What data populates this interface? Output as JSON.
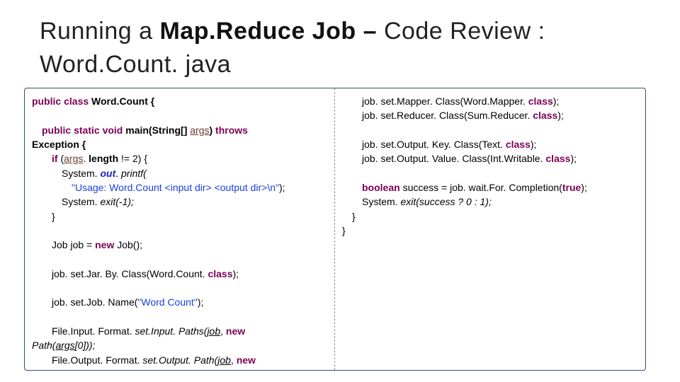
{
  "title": {
    "pre": "Running a ",
    "bold1": "Map.Reduce Job – ",
    "post": "Code Review :",
    "sub": "Word.Count. java"
  },
  "left": {
    "l1a": "public class ",
    "l1b": "Word.Count {",
    "l2a": "public static void ",
    "l2b": "main(String[] ",
    "l2c": "args",
    "l2d": ") ",
    "l2e": "throws",
    "l3a": "Exception {",
    "l4a": "if ",
    "l4b": "(",
    "l4c": "args",
    "l4d": ". ",
    "l4e": "length",
    "l4f": " != 2) {",
    "l5a": "System. ",
    "l5b": "out",
    "l5c": ". ",
    "l5d": "printf(",
    "l6a": "\"Usage: Word.Count <input dir> <output dir>\\n\"",
    "l6b": ");",
    "l7a": "System. ",
    "l7b": "exit(-1);",
    "l8a": "}",
    "l9a": "Job job = ",
    "l9b": "new ",
    "l9c": "Job();",
    "l10a": "job. set.Jar. By. Class(Word.Count. ",
    "l10b": "class",
    "l10c": ");",
    "l11a": "job. set.Job. Name(",
    "l11b": "\"Word Count\"",
    "l11c": ");",
    "l12a": "File.Input. Format. ",
    "l12b": "set.Input. Paths(",
    "l12c": "job",
    "l12d": ", ",
    "l12e": "new",
    "l13a": "Path(",
    "l13b": "args",
    "l13c": "[0]));",
    "l14a": "File.Output. Format. ",
    "l14b": "set.Output. Path(",
    "l14c": "job",
    "l14d": ", ",
    "l14e": "new"
  },
  "right": {
    "l1a": "job. set.Mapper. Class(Word.Mapper. ",
    "l1b": "class",
    "l1c": ");",
    "l2a": "job. set.Reducer. Class(Sum.Reducer. ",
    "l2b": "class",
    "l2c": ");",
    "l3a": "job. set.Output. Key. Class(Text. ",
    "l3b": "class",
    "l3c": ");",
    "l4a": "job. set.Output. Value. Class(Int.Writable. ",
    "l4b": "class",
    "l4c": ");",
    "l5a": "boolean ",
    "l5b": "success = job. wait.For. Completion(",
    "l5c": "true",
    "l5d": ");",
    "l6a": "System. ",
    "l6b": "exit(success ? 0 : 1);",
    "l7a": "}",
    "l8a": "}"
  }
}
